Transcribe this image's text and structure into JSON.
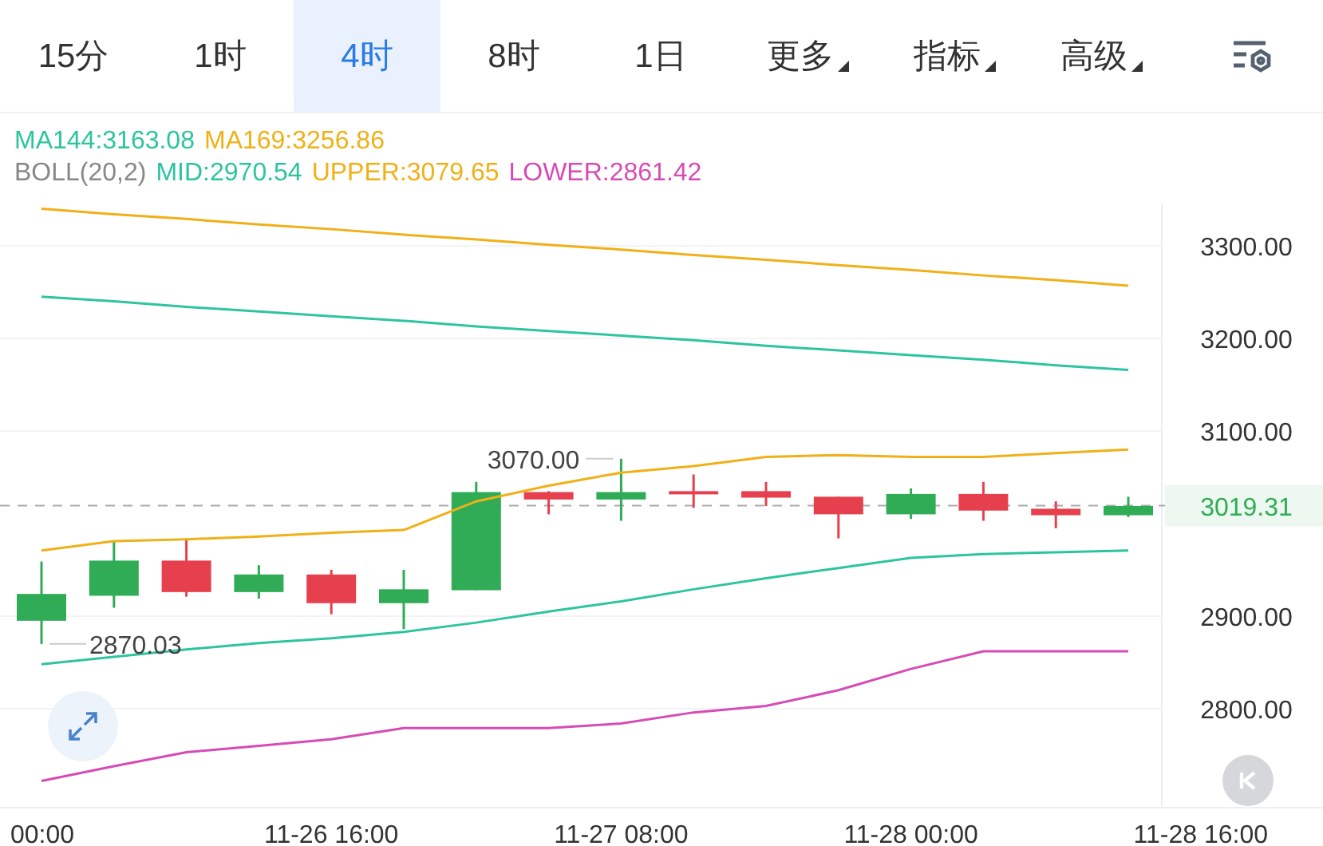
{
  "tabs": [
    {
      "label": "15分",
      "selected": false,
      "kind": "plain"
    },
    {
      "label": "1时",
      "selected": false,
      "kind": "plain"
    },
    {
      "label": "4时",
      "selected": true,
      "kind": "plain"
    },
    {
      "label": "8时",
      "selected": false,
      "kind": "plain"
    },
    {
      "label": "1日",
      "selected": false,
      "kind": "plain"
    },
    {
      "label": "更多",
      "selected": false,
      "kind": "menu"
    },
    {
      "label": "指标",
      "selected": false,
      "kind": "menu"
    },
    {
      "label": "高级",
      "selected": false,
      "kind": "menu"
    }
  ],
  "legend": [
    [
      {
        "text": "MA144:3163.08",
        "color": "#2ec4a0"
      },
      {
        "text": "MA169:3256.86",
        "color": "#f0b017"
      }
    ],
    [
      {
        "text": "BOLL(20,2)",
        "color": "#888888"
      },
      {
        "text": "MID:2970.54",
        "color": "#2ec4a0"
      },
      {
        "text": "UPPER:3079.65",
        "color": "#f0b017"
      },
      {
        "text": "LOWER:2861.42",
        "color": "#d64bb5"
      }
    ]
  ],
  "chart_data": {
    "type": "line",
    "categories": [
      "00:00",
      null,
      null,
      null,
      "11-26 16:00",
      null,
      null,
      null,
      "11-27 08:00",
      null,
      null,
      null,
      "11-28 00:00",
      null,
      null,
      null,
      "11-28 16:00"
    ],
    "ylim": [
      2693.1,
      3344.83
    ],
    "grid": true,
    "ref_lines": [
      {
        "axis": "y",
        "value": 3019.31,
        "label": "3019.31"
      }
    ],
    "yticks": [
      {
        "value": 3300,
        "label": "3300.00"
      },
      {
        "value": 3200,
        "label": "3200.00"
      },
      {
        "value": 3100,
        "label": "3100.00"
      },
      {
        "value": 2900,
        "label": "2900.00"
      },
      {
        "value": 2800,
        "label": "2800.00"
      }
    ],
    "series": [
      {
        "color": "#f0b017",
        "values": [
          3340,
          3334,
          3329,
          3323,
          3318,
          3312,
          3307,
          3301,
          3296,
          3290,
          3285,
          3279,
          3274,
          3268,
          3263,
          3257,
          null
        ]
      },
      {
        "color": "#2ec4a0",
        "values": [
          3245,
          3240,
          3234,
          3229,
          3224,
          3219,
          3213,
          3208,
          3203,
          3198,
          3192,
          3187,
          3182,
          3177,
          3171,
          3166,
          null
        ]
      },
      {
        "color": "#f0b017",
        "values": [
          2971,
          2981,
          2983,
          2986,
          2990,
          2993,
          3024,
          3041,
          3055,
          3062,
          3072,
          3074,
          3072,
          3072,
          3076,
          3080,
          null
        ]
      },
      {
        "color": "#2ec4a0",
        "values": [
          2848,
          2856,
          2864,
          2871,
          2876,
          2883,
          2893,
          2905,
          2916,
          2929,
          2941,
          2952,
          2963,
          2967,
          2969,
          2971,
          null
        ]
      },
      {
        "color": "#d64bb5",
        "values": [
          2722,
          2738,
          2753,
          2760,
          2767,
          2779,
          2779,
          2779,
          2784,
          2796,
          2803,
          2820,
          2843,
          2862,
          2862,
          2862,
          null
        ]
      }
    ],
    "annotations": [
      "3070.00",
      "2870.03"
    ]
  }
}
